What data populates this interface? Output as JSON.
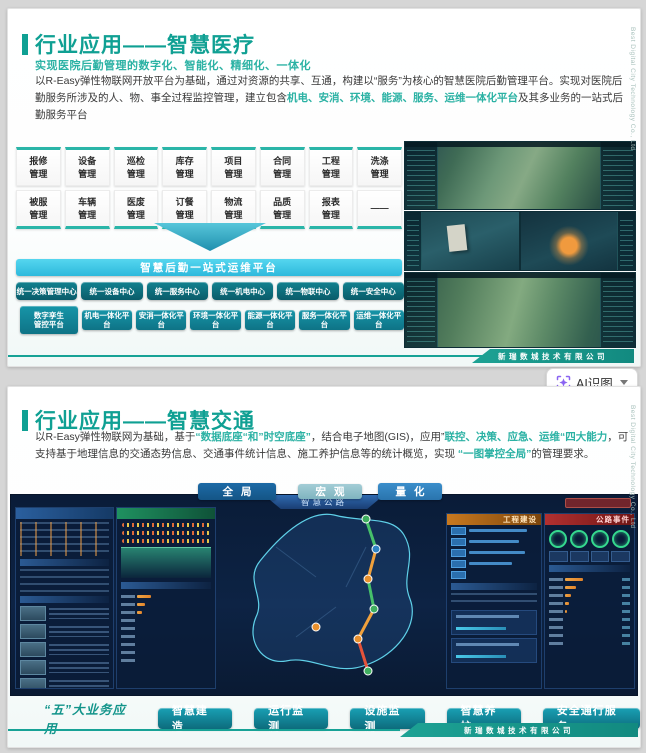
{
  "ai_button": {
    "label": "AI识图"
  },
  "company_en": "Best Digital City Technology Co., Ltd",
  "slide1": {
    "title": "行业应用——智慧医疗",
    "subtitle": "实现医院后勤管理的数字化、智能化、精细化、一体化",
    "para": {
      "p1": "以R-Easy弹性物联网开放平台为基础，通过对资源的共享、互通，构建以“服务”为核心的智慧医院后勤管理平台。实现对医院后勤服务所涉及的人、物、事全过程监控管理，建立包含",
      "h1": "机电、安消、环境、能源、服务、运维一体化平台",
      "p2": "及其多业务的一站式后勤服务平台"
    },
    "modules_row1": [
      "报修管理",
      "设备管理",
      "巡检管理",
      "库存管理",
      "项目管理",
      "合同管理",
      "工程管理",
      "洗涤管理"
    ],
    "modules_row2": [
      "被服管理",
      "车辆管理",
      "医废管理",
      "订餐管理",
      "物流管理",
      "品质管理",
      "报表管理",
      "——"
    ],
    "banner": "智慧后勤一站式运维平台",
    "centers": [
      "统一决策管理中心",
      "统一设备中心",
      "统一服务中心",
      "统一机电中心",
      "统一物联中心",
      "统一安全中心"
    ],
    "platforms": [
      "数字孪生管控平台",
      "机电一体化平台",
      "安消一体化平台",
      "环境一体化平台",
      "能源一体化平台",
      "服务一体化平台",
      "运维一体化平台"
    ],
    "footer": "新瑞数城技术有限公司"
  },
  "slide2": {
    "title": "行业应用——智慧交通",
    "para": {
      "p1": "以R-Easy弹性物联网为基础，基于",
      "h1": "“数据底座“和”时空底座”",
      "p2": "，结合电子地图(GIS)，应用”",
      "h2": "联控、决策、应急、运维“四大能力",
      "p3": "，可支持基于地理信息的交通态势信息、交通事件统计信息、施工养护信息等的统计概览，实现 ",
      "h3": "“一图掌控全局”",
      "p4": "的管理要求。"
    },
    "tabs": [
      "全局",
      "宏观",
      "量化"
    ],
    "dashboard": {
      "title": "智慧公路",
      "panel_construction": "工程建设",
      "panel_events": "公路事件"
    },
    "apps_label": "“五”大业务应用",
    "apps": [
      "智慧建造",
      "运行监测",
      "设施监测",
      "智慧养护",
      "安全通行服务"
    ],
    "footer": "新瑞数城技术有限公司"
  },
  "colors": {
    "accent": "#0fa093",
    "highlight": "#2bb2a4",
    "banner_cyan": "#3ec9e8",
    "navy": "#0a1c38",
    "orange": "#e09a3c",
    "red": "#b23030",
    "green": "#1f9160"
  }
}
